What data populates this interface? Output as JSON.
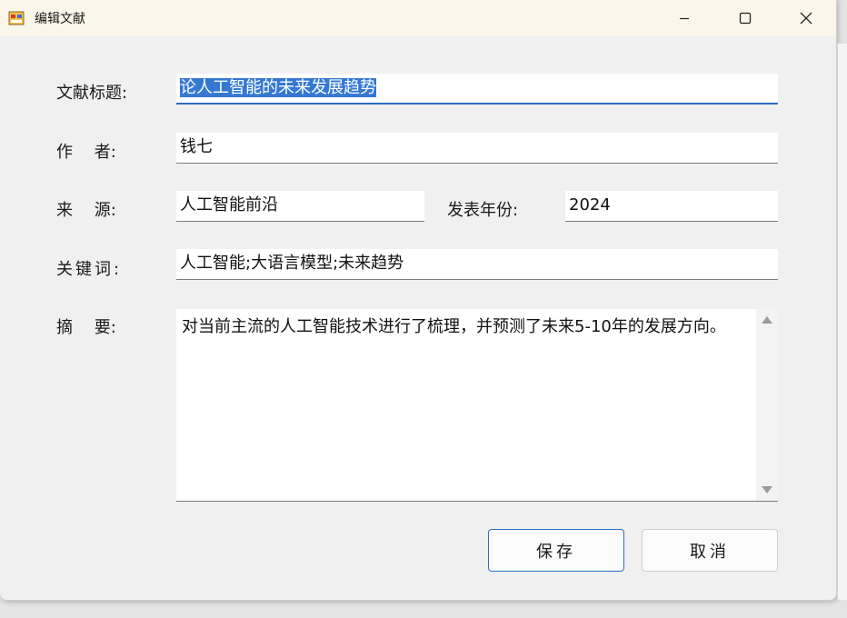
{
  "window": {
    "title": "编辑文献",
    "icon": "app-form-icon"
  },
  "form": {
    "title_label": "文献标题:",
    "title_value": "论人工智能的未来发展趋势",
    "author_label": "作　 者:",
    "author_value": "钱七",
    "source_label": "来　 源:",
    "source_value": "人工智能前沿",
    "year_label": "发表年份:",
    "year_value": "2024",
    "keywords_label": "关键词:",
    "keywords_value": "人工智能;大语言模型;未来趋势",
    "abstract_label": "摘　 要:",
    "abstract_value": "对当前主流的人工智能技术进行了梳理，并预测了未来5-10年的发展方向。"
  },
  "buttons": {
    "save": "保存",
    "cancel": "取消"
  }
}
